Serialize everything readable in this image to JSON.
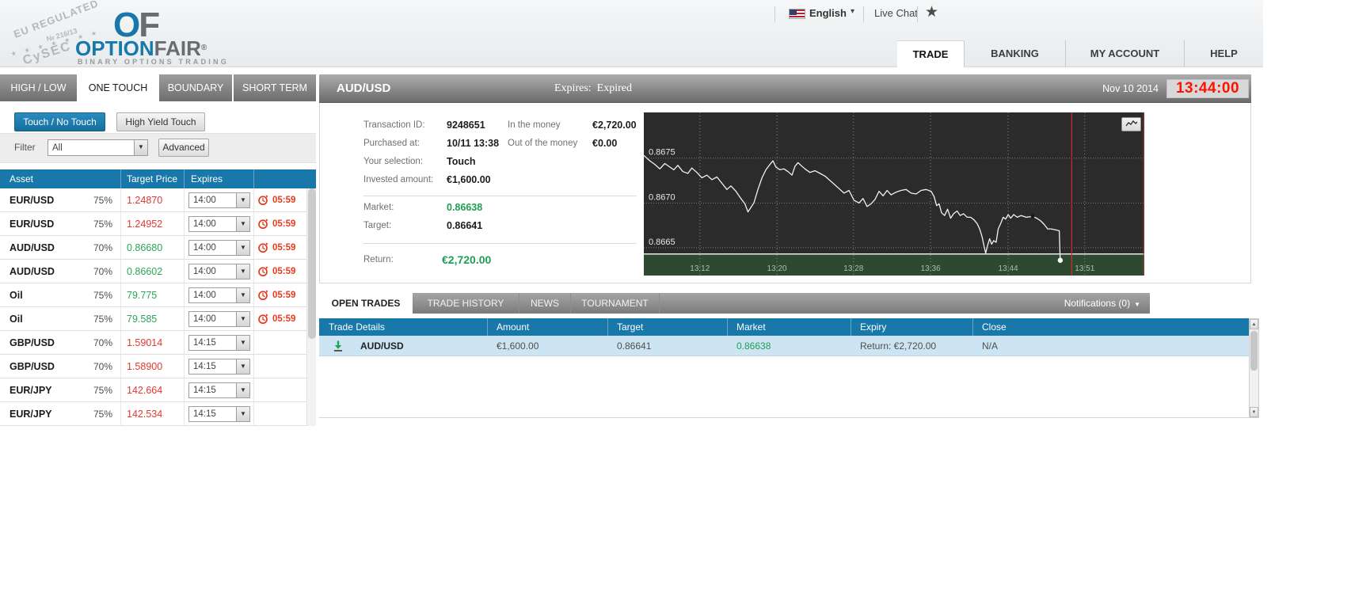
{
  "colors": {
    "accent_blue": "#1878aa",
    "price_red": "#e4372e",
    "price_green": "#2aa558",
    "timer_red": "#e8391d",
    "clock_red": "#ff1300",
    "chart_bg": "#2b2b2b",
    "chart_zone_green": "#2d4a31",
    "chart_expiry_line": "#cf2c21",
    "row_highlight": "#cde4f2"
  },
  "icons": {
    "chevron_down": "▾",
    "select_arrow": "▼",
    "star": "★",
    "notification_caret": "▼",
    "scroll_up": "▲",
    "scroll_down": "▼"
  },
  "header": {
    "logo": {
      "stamp_line1": "EU REGULATED",
      "stamp_line2": "№ 216/13",
      "stamp_stars": "★ ★ ★ ★ ★ ★ ★",
      "stamp_line3": "CySEC",
      "mark_o": "O",
      "mark_f": "F",
      "brand_option": "OPTION",
      "brand_fair": "FAIR",
      "reg_mark": "®",
      "tagline": "BINARY OPTIONS TRADING"
    },
    "language": "English",
    "live_chat": "Live Chat",
    "nav": [
      {
        "label": "TRADE",
        "active": true
      },
      {
        "label": "BANKING",
        "active": false
      },
      {
        "label": "MY ACCOUNT",
        "active": false
      },
      {
        "label": "HELP",
        "active": false
      }
    ]
  },
  "left_panel": {
    "tabs": [
      {
        "label": "HIGH / LOW",
        "active": false
      },
      {
        "label": "ONE TOUCH",
        "active": true
      },
      {
        "label": "BOUNDARY",
        "active": false
      },
      {
        "label": "SHORT TERM",
        "active": false
      }
    ],
    "subtabs": [
      {
        "label": "Touch / No Touch",
        "active": true
      },
      {
        "label": "High Yield Touch",
        "active": false
      }
    ],
    "filter": {
      "label": "Filter",
      "value": "All",
      "advanced_label": "Advanced"
    },
    "table": {
      "headers": [
        "Asset",
        "Target Price",
        "Expires"
      ],
      "rows": [
        {
          "asset": "EUR/USD",
          "payout": "75%",
          "price": "1.24870",
          "dir": "down",
          "expires": "14:00",
          "timer": "05:59"
        },
        {
          "asset": "EUR/USD",
          "payout": "75%",
          "price": "1.24952",
          "dir": "down",
          "expires": "14:00",
          "timer": "05:59"
        },
        {
          "asset": "AUD/USD",
          "payout": "70%",
          "price": "0.86680",
          "dir": "up",
          "expires": "14:00",
          "timer": "05:59"
        },
        {
          "asset": "AUD/USD",
          "payout": "70%",
          "price": "0.86602",
          "dir": "up",
          "expires": "14:00",
          "timer": "05:59"
        },
        {
          "asset": "Oil",
          "payout": "75%",
          "price": "79.775",
          "dir": "up",
          "expires": "14:00",
          "timer": "05:59"
        },
        {
          "asset": "Oil",
          "payout": "75%",
          "price": "79.585",
          "dir": "up",
          "expires": "14:00",
          "timer": "05:59"
        },
        {
          "asset": "GBP/USD",
          "payout": "70%",
          "price": "1.59014",
          "dir": "down",
          "expires": "14:15",
          "timer": ""
        },
        {
          "asset": "GBP/USD",
          "payout": "70%",
          "price": "1.58900",
          "dir": "down",
          "expires": "14:15",
          "timer": ""
        },
        {
          "asset": "EUR/JPY",
          "payout": "75%",
          "price": "142.664",
          "dir": "down",
          "expires": "14:15",
          "timer": ""
        },
        {
          "asset": "EUR/JPY",
          "payout": "75%",
          "price": "142.534",
          "dir": "down",
          "expires": "14:15",
          "timer": ""
        }
      ]
    }
  },
  "trade_panel": {
    "title": "AUD/USD",
    "expires_label": "Expires:",
    "expires_value": "Expired",
    "date": "Nov 10 2014",
    "clock": "13:44:00",
    "details_left": [
      {
        "label": "Transaction ID:",
        "value": "9248651"
      },
      {
        "label": "Purchased at:",
        "value": "10/11 13:38"
      },
      {
        "label": "Your selection:",
        "value": "Touch"
      },
      {
        "label": "Invested amount:",
        "value": "€1,600.00"
      }
    ],
    "details_right": [
      {
        "label": "In the money",
        "value": "€2,720.00"
      },
      {
        "label": "Out of the money",
        "value": "€0.00"
      }
    ],
    "market_label": "Market:",
    "market_value": "0.86638",
    "target_label": "Target:",
    "target_value": "0.86641",
    "return_label": "Return:",
    "return_value": "€2,720.00"
  },
  "chart_data": {
    "type": "line",
    "symbol": "AUD/USD",
    "y_ticks": [
      0.8675,
      0.867,
      0.8665
    ],
    "ylim": [
      0.86619,
      0.86801
    ],
    "x_ticks": [
      {
        "f": 0.112,
        "label": "13:12"
      },
      {
        "f": 0.266,
        "label": "13:20"
      },
      {
        "f": 0.419,
        "label": "13:28"
      },
      {
        "f": 0.573,
        "label": "13:36"
      },
      {
        "f": 0.728,
        "label": "13:44"
      },
      {
        "f": 0.881,
        "label": "13:51"
      }
    ],
    "target_level": 0.86643,
    "green_zone_below": 0.86643,
    "expiry_marker_f": 0.855,
    "end_dot": {
      "f": 0.832,
      "price": 0.86636
    },
    "purchase_dot": {
      "f": 0.777,
      "price": 0.86685
    },
    "grid": true,
    "legend": "none",
    "series": [
      {
        "name": "AUD/USD",
        "points": [
          [
            0.0,
            0.86753
          ],
          [
            0.012,
            0.86747
          ],
          [
            0.022,
            0.86743
          ],
          [
            0.032,
            0.86738
          ],
          [
            0.042,
            0.86744
          ],
          [
            0.052,
            0.8674
          ],
          [
            0.06,
            0.86737
          ],
          [
            0.068,
            0.86742
          ],
          [
            0.078,
            0.86735
          ],
          [
            0.088,
            0.86733
          ],
          [
            0.096,
            0.86739
          ],
          [
            0.106,
            0.86734
          ],
          [
            0.116,
            0.86728
          ],
          [
            0.126,
            0.86731
          ],
          [
            0.136,
            0.86726
          ],
          [
            0.146,
            0.86729
          ],
          [
            0.156,
            0.86722
          ],
          [
            0.166,
            0.86715
          ],
          [
            0.174,
            0.86719
          ],
          [
            0.184,
            0.86713
          ],
          [
            0.194,
            0.86705
          ],
          [
            0.202,
            0.86699
          ],
          [
            0.208,
            0.8669
          ],
          [
            0.214,
            0.86695
          ],
          [
            0.22,
            0.867
          ],
          [
            0.228,
            0.86715
          ],
          [
            0.236,
            0.86728
          ],
          [
            0.244,
            0.86737
          ],
          [
            0.252,
            0.86743
          ],
          [
            0.258,
            0.86747
          ],
          [
            0.264,
            0.8674
          ],
          [
            0.272,
            0.86737
          ],
          [
            0.28,
            0.86738
          ],
          [
            0.288,
            0.86735
          ],
          [
            0.296,
            0.86731
          ],
          [
            0.302,
            0.86741
          ],
          [
            0.308,
            0.86745
          ],
          [
            0.314,
            0.86742
          ],
          [
            0.322,
            0.86738
          ],
          [
            0.332,
            0.86734
          ],
          [
            0.342,
            0.86736
          ],
          [
            0.352,
            0.86733
          ],
          [
            0.362,
            0.8673
          ],
          [
            0.372,
            0.86725
          ],
          [
            0.38,
            0.86721
          ],
          [
            0.39,
            0.86716
          ],
          [
            0.4,
            0.86711
          ],
          [
            0.41,
            0.86714
          ],
          [
            0.42,
            0.86703
          ],
          [
            0.43,
            0.867
          ],
          [
            0.438,
            0.86705
          ],
          [
            0.446,
            0.86696
          ],
          [
            0.454,
            0.86699
          ],
          [
            0.462,
            0.86704
          ],
          [
            0.47,
            0.86713
          ],
          [
            0.478,
            0.86708
          ],
          [
            0.486,
            0.86714
          ],
          [
            0.494,
            0.86709
          ],
          [
            0.504,
            0.86712
          ],
          [
            0.514,
            0.86714
          ],
          [
            0.524,
            0.86715
          ],
          [
            0.534,
            0.86711
          ],
          [
            0.544,
            0.8671
          ],
          [
            0.554,
            0.86714
          ],
          [
            0.564,
            0.86715
          ],
          [
            0.574,
            0.86713
          ],
          [
            0.58,
            0.86707
          ],
          [
            0.585,
            0.86697
          ],
          [
            0.59,
            0.86699
          ],
          [
            0.595,
            0.86689
          ],
          [
            0.601,
            0.86686
          ],
          [
            0.607,
            0.86693
          ],
          [
            0.613,
            0.86683
          ],
          [
            0.619,
            0.86688
          ],
          [
            0.626,
            0.86691
          ],
          [
            0.632,
            0.86686
          ],
          [
            0.639,
            0.86688
          ],
          [
            0.646,
            0.86684
          ],
          [
            0.653,
            0.86684
          ],
          [
            0.66,
            0.86681
          ],
          [
            0.666,
            0.86677
          ],
          [
            0.671,
            0.86671
          ],
          [
            0.676,
            0.86662
          ],
          [
            0.68,
            0.86651
          ],
          [
            0.683,
            0.86644
          ],
          [
            0.687,
            0.86653
          ],
          [
            0.691,
            0.8666
          ],
          [
            0.695,
            0.86654
          ],
          [
            0.699,
            0.86658
          ],
          [
            0.704,
            0.86656
          ],
          [
            0.708,
            0.86671
          ],
          [
            0.713,
            0.86677
          ],
          [
            0.718,
            0.86684
          ],
          [
            0.723,
            0.86682
          ],
          [
            0.728,
            0.86687
          ],
          [
            0.733,
            0.86683
          ],
          [
            0.739,
            0.86687
          ],
          [
            0.746,
            0.86684
          ],
          [
            0.754,
            0.86686
          ],
          [
            0.764,
            0.86684
          ],
          [
            0.777,
            0.86685
          ],
          [
            0.785,
            0.86683
          ],
          [
            0.793,
            0.8668
          ],
          [
            0.8,
            0.86676
          ],
          [
            0.807,
            0.86671
          ],
          [
            0.814,
            0.86671
          ],
          [
            0.822,
            0.8667
          ],
          [
            0.83,
            0.86669
          ],
          [
            0.832,
            0.86636
          ]
        ]
      }
    ]
  },
  "bottom": {
    "tabs": [
      {
        "label": "OPEN TRADES",
        "active": true
      },
      {
        "label": "TRADE HISTORY",
        "active": false
      },
      {
        "label": "NEWS",
        "active": false
      },
      {
        "label": "TOURNAMENT",
        "active": false
      }
    ],
    "notifications_label": "Notifications (0)",
    "table": {
      "headers": [
        "Trade Details",
        "Amount",
        "Target",
        "Market",
        "Expiry",
        "Close"
      ],
      "rows": [
        {
          "asset": "AUD/USD",
          "amount": "€1,600.00",
          "target": "0.86641",
          "market": "0.86638",
          "expiry": "Return: €2,720.00",
          "close": "N/A"
        }
      ]
    }
  }
}
